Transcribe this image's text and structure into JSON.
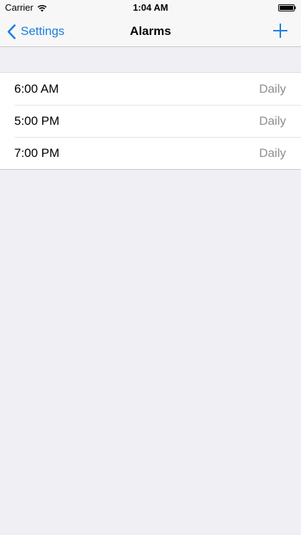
{
  "status_bar": {
    "carrier": "Carrier",
    "time": "1:04 AM",
    "wifi_icon": "wifi-icon",
    "battery_icon": "battery-icon"
  },
  "nav": {
    "back_label": "Settings",
    "back_icon": "chevron-left-icon",
    "title": "Alarms",
    "add_icon": "plus-icon",
    "accent_color": "#1a7de0"
  },
  "alarms": [
    {
      "time": "6:00 AM",
      "repeat": "Daily"
    },
    {
      "time": "5:00 PM",
      "repeat": "Daily"
    },
    {
      "time": "7:00 PM",
      "repeat": "Daily"
    }
  ],
  "colors": {
    "background": "#efeff4",
    "list_background": "#ffffff",
    "secondary_text": "#8e8e93"
  }
}
